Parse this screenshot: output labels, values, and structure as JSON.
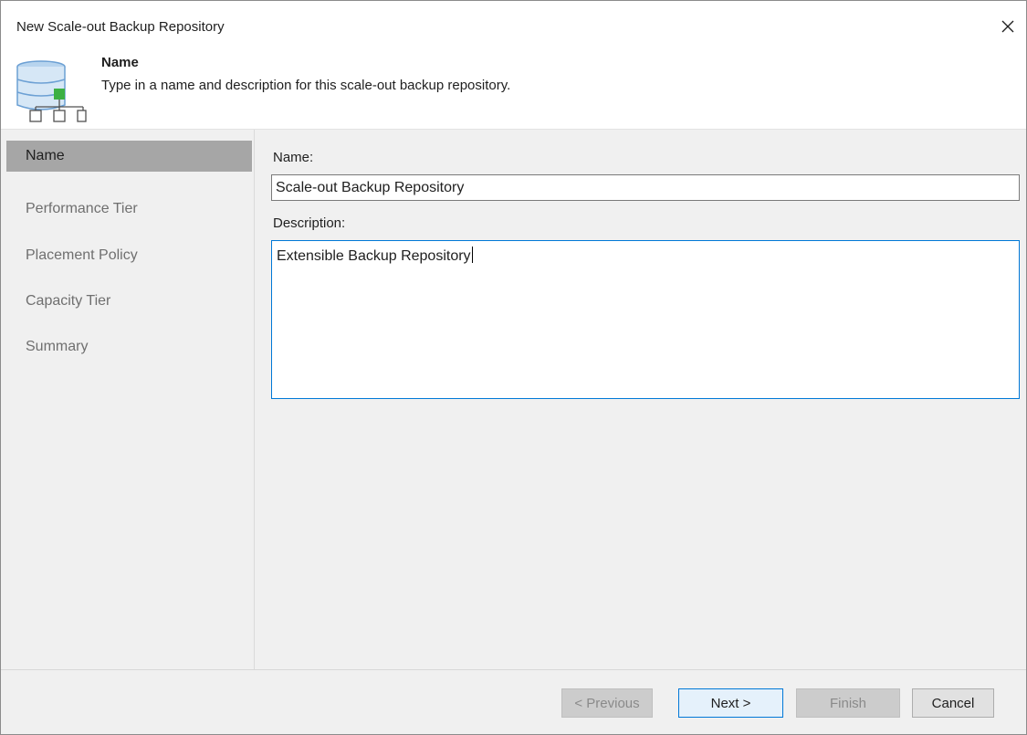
{
  "window": {
    "title": "New Scale-out Backup Repository"
  },
  "header": {
    "icon": "scale-out-repository-icon",
    "title": "Name",
    "subtitle": "Type in a name and description for this scale-out backup repository."
  },
  "nav": {
    "items": [
      {
        "label": "Name",
        "active": true
      },
      {
        "label": "Performance Tier",
        "active": false
      },
      {
        "label": "Placement Policy",
        "active": false
      },
      {
        "label": "Capacity Tier",
        "active": false
      },
      {
        "label": "Summary",
        "active": false
      }
    ]
  },
  "form": {
    "name_label": "Name:",
    "name_value": "Scale-out Backup Repository",
    "description_label": "Description:",
    "description_value": "Extensible Backup Repository"
  },
  "footer": {
    "previous_label": "< Previous",
    "next_label": "Next >",
    "finish_label": "Finish",
    "cancel_label": "Cancel"
  },
  "colors": {
    "accent": "#0078d7",
    "nav_active_bg": "#a6a6a6",
    "panel_bg": "#f0f0f0",
    "repo_icon_blue": "#6ca0d4",
    "repo_icon_green": "#3cb043"
  }
}
